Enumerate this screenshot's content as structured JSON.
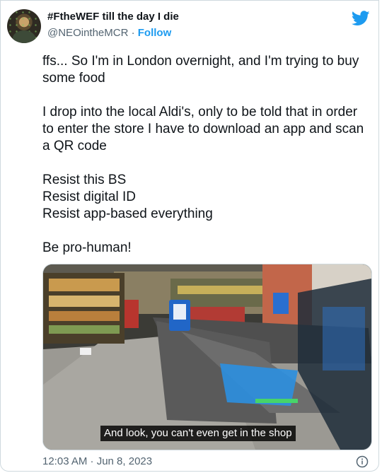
{
  "author": {
    "display_name": "#FtheWEF till the day I die",
    "handle": "@NEOintheMCR",
    "separator": "·",
    "follow_label": "Follow"
  },
  "tweet": {
    "text": "ffs... So I'm in London overnight, and I'm trying to buy some food\n\nI drop into the local Aldi's, only to be told that in order to enter the store I have to download an app and scan a QR code\n\nResist this BS\nResist digital ID\nResist app-based everything\n\nBe pro-human!"
  },
  "media": {
    "caption": "And look, you can't even get in the shop"
  },
  "footer": {
    "timestamp": "12:03 AM · Jun 8, 2023"
  },
  "icons": {
    "brand": "twitter-bird-icon",
    "info": "info-icon"
  },
  "colors": {
    "accent": "#1d9bf0",
    "secondary_text": "#536471",
    "border": "#cfd9de"
  }
}
